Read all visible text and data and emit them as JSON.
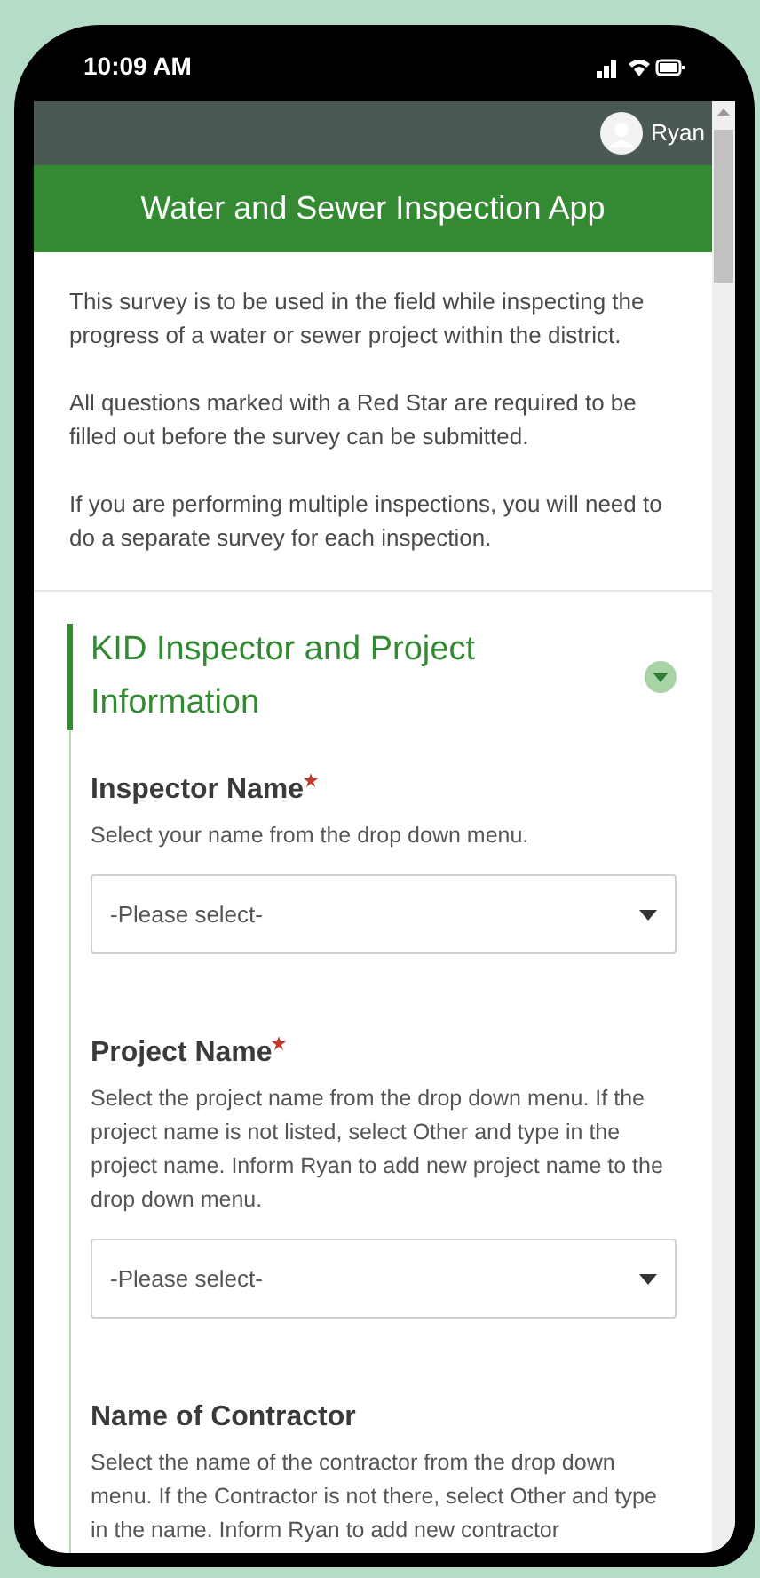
{
  "status_bar": {
    "time": "10:09 AM"
  },
  "header": {
    "user": "Ryan"
  },
  "banner": {
    "title": "Water and Sewer Inspection App"
  },
  "intro": [
    "This survey is to be used in the field while inspecting the progress of a water or sewer project within the district.",
    "All questions marked with a Red Star are required to be filled out before the survey can be submitted.",
    "If you are performing multiple inspections, you will need to do a separate survey for each inspection."
  ],
  "section": {
    "title": "KID Inspector and Project Information",
    "expanded": true,
    "questions": [
      {
        "label": "Inspector Name",
        "required": true,
        "hint": "Select your name from the drop down menu.",
        "placeholder": "-Please select-"
      },
      {
        "label": "Project Name",
        "required": true,
        "hint": "Select the project name from the drop down menu. If the project name is not listed, select Other and type in the project name. Inform Ryan to add new project name to the drop down menu.",
        "placeholder": "-Please select-"
      },
      {
        "label": "Name of Contractor",
        "required": false,
        "hint": "Select the name of the contractor from the drop down menu. If the Contractor is not there, select Other and type in the name. Inform Ryan to add new contractor"
      }
    ]
  }
}
